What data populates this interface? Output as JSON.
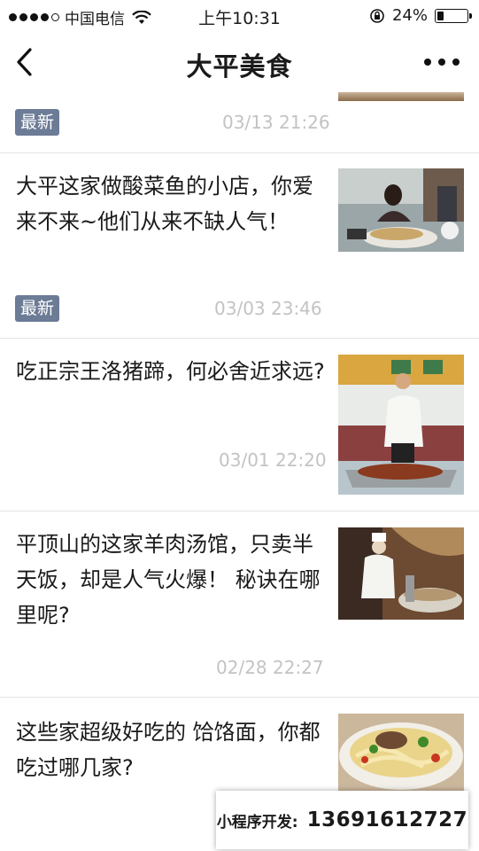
{
  "statusbar": {
    "carrier": "中国电信",
    "time": "上午10:31",
    "battery": "24%",
    "battery_level": 0.24
  },
  "nav": {
    "title": "大平美食"
  },
  "articles": [
    {
      "badge": "最新",
      "date": "03/13 21:26"
    },
    {
      "title": "大平这家做酸菜鱼的小店，你爱来不来~他们从来不缺人气！",
      "badge": "最新",
      "date": "03/03 23:46"
    },
    {
      "title": "吃正宗王洛猪蹄，何必舍近求远?",
      "date": "03/01 22:20"
    },
    {
      "title": "平顶山的这家羊肉汤馆，只卖半天饭，却是人气火爆！ 秘诀在哪里呢?",
      "date": "02/28 22:27"
    },
    {
      "title": "这些家超级好吃的 饸饹面，你都吃过哪几家?"
    }
  ],
  "banner": {
    "label": "小程序开发:",
    "phone": "13691612727"
  }
}
